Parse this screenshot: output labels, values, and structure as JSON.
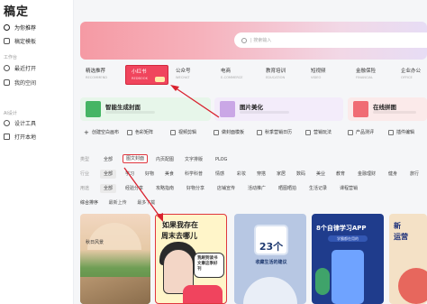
{
  "app": {
    "logo": "稿定"
  },
  "sidebar": {
    "items": [
      {
        "label": "为你推荐",
        "icon": "compass-icon",
        "active": true
      },
      {
        "label": "稿定模板",
        "icon": "template-icon",
        "active": false
      }
    ],
    "groups": [
      {
        "label": "工作台",
        "items": [
          {
            "label": "最近打开",
            "icon": "clock-icon"
          },
          {
            "label": "我的空间",
            "icon": "folder-icon"
          }
        ]
      },
      {
        "label": "AI设计",
        "items": [
          {
            "label": "设计工具",
            "icon": "design-icon"
          },
          {
            "label": "打开本地",
            "icon": "upload-icon"
          }
        ]
      }
    ]
  },
  "search": {
    "placeholder": "| 搜索输入"
  },
  "categories": [
    {
      "label": "精选推荐",
      "sub": "RECOMMEND"
    },
    {
      "label": "小红书",
      "sub": "REDBOOK",
      "selected": true
    },
    {
      "label": "公众号",
      "sub": "WECHAT"
    },
    {
      "label": "电商",
      "sub": "E-COMMERCE"
    },
    {
      "label": "教育培训",
      "sub": "EDUCATION"
    },
    {
      "label": "短视频",
      "sub": "VIDEO"
    },
    {
      "label": "金融保险",
      "sub": "FINANCIAL"
    },
    {
      "label": "企业办公",
      "sub": "OFFICE"
    }
  ],
  "features": [
    {
      "title": "智能生成封面",
      "bg": "#e7f6ea",
      "thumb": "#45b564"
    },
    {
      "title": "图片美化",
      "bg": "#f3ecfa",
      "thumb": "#caa7e6"
    },
    {
      "title": "在线拼图",
      "bg": "#fbeaea",
      "thumb": "#f06c74"
    }
  ],
  "tools": [
    {
      "label": "创建空白画布",
      "icon": "plus-icon"
    },
    {
      "label": "色彩矩阵",
      "icon": "palette-icon"
    },
    {
      "label": "视频剪辑",
      "icon": "video-icon"
    },
    {
      "label": "做封面模板",
      "icon": "image-icon"
    },
    {
      "label": "秋季营销日历",
      "icon": "calendar-icon"
    },
    {
      "label": "营销玩法",
      "icon": "gift-icon"
    },
    {
      "label": "产品测评",
      "icon": "star-icon"
    },
    {
      "label": "插件编辑",
      "icon": "plugin-icon"
    }
  ],
  "filters": {
    "type_label": "类型",
    "types": [
      "全部",
      "图文封面",
      "内页配图",
      "文字排版",
      "PLOG"
    ],
    "type_selected": "图文封面",
    "industry_label": "行业",
    "industries": [
      "全部",
      "学习",
      "好物",
      "美食",
      "科学科普",
      "情感",
      "彩妆",
      "穿搭",
      "家居",
      "数码",
      "美业",
      "教育",
      "金融理财",
      "健身",
      "旅行"
    ],
    "industry_selected": "全部",
    "use_label": "用途",
    "uses": [
      "全部",
      "经验分享",
      "攻略指南",
      "好物分享",
      "店铺宣传",
      "活动推广",
      "晒图晒拍",
      "生活记录",
      "课程营销"
    ],
    "use_selected": "全部"
  },
  "sort": {
    "options": [
      "综合排序",
      "最新上传",
      "最多下载"
    ]
  },
  "cards": [
    {
      "kind": "photo",
      "caption": "秋日风景"
    },
    {
      "kind": "illustration",
      "line1": "如果我存在",
      "line2": "周末去哪儿",
      "bubble": "我刷到读书文章这季好刊"
    },
    {
      "kind": "tips",
      "number": "23个",
      "subtitle": "收藏生活的建议"
    },
    {
      "kind": "promo",
      "title": "8个自律学习APP",
      "pill": "学霸都在用的"
    },
    {
      "kind": "text",
      "line1": "新",
      "line2": "运营"
    }
  ],
  "colors": {
    "accent": "#f0455d",
    "highlight_border": "#e0363e",
    "arrow": "#d9222f"
  }
}
